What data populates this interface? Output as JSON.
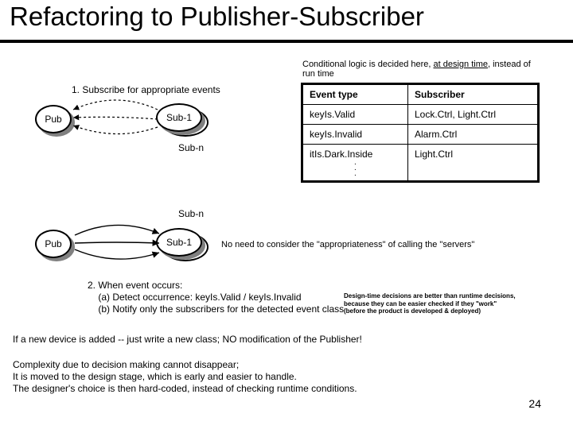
{
  "title": "Refactoring to Publisher-Subscriber",
  "cond_note_a": "Conditional logic is decided here, ",
  "cond_note_b": "at design time",
  "cond_note_c": ", instead of run time",
  "step1": "1. Subscribe for appropriate events",
  "pub_label": "Pub",
  "sub1_label": "Sub-1",
  "subn_label": "Sub-n",
  "table": {
    "headers": {
      "event": "Event type",
      "subscriber": "Subscriber"
    },
    "rows": [
      {
        "event": "keyIs.Valid",
        "sub": "Lock.Ctrl, Light.Ctrl"
      },
      {
        "event": "keyIs.Invalid",
        "sub": "Alarm.Ctrl"
      },
      {
        "event": "itIs.Dark.Inside",
        "sub": "Light.Ctrl"
      }
    ]
  },
  "noneed": "No need to consider the \"appropriateness\" of calling the \"servers\"",
  "step2_l1": "2. When event occurs:",
  "step2_l2": "    (a) Detect occurrence: keyIs.Valid / keyIs.Invalid",
  "step2_l3": "    (b) Notify only the subscribers for the detected event class",
  "designnote_l1": "Design-time decisions are better than runtime decisions,",
  "designnote_l2": "because they can be easier checked if they \"work\"",
  "designnote_l3": "(before the product is developed & deployed)",
  "ifnew": "If a new device is added -- just write a new class; NO modification of the Publisher!",
  "complexity_l1": "Complexity due to decision making cannot disappear;",
  "complexity_l2": "It is moved to the design stage, which is early and easier to handle.",
  "complexity_l3": "The designer's choice is then hard-coded, instead of checking runtime conditions.",
  "pagenum": "24"
}
